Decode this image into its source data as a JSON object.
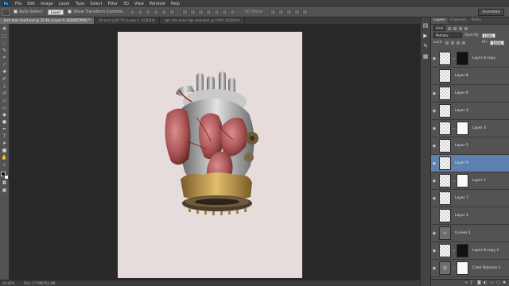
{
  "menubar": {
    "logo": "Ps",
    "items": [
      "File",
      "Edit",
      "Image",
      "Layer",
      "Type",
      "Select",
      "Filter",
      "3D",
      "View",
      "Window",
      "Help"
    ]
  },
  "options": {
    "auto_select_label": "Auto-Select:",
    "auto_select_value": "Layer",
    "transform_label": "Show Transform Controls",
    "mode_3d": "3D Mode:",
    "workspace": "Essentials"
  },
  "tabs": [
    {
      "label": "krrrr.mou heart.psd @ 33.4% (Layer 9, RGB/8/CMYK) *",
      "active": true
    },
    {
      "label": "fm.psd @ 66.7% (Layer 1, RGB/8#)",
      "active": false
    },
    {
      "label": "ngit ede webe itgo workspac @ 100% (RGB/8#)",
      "active": false
    }
  ],
  "status": {
    "zoom": "33.42%",
    "doc": "Doc: 17.0M/152.4M"
  },
  "panel": {
    "tabs": [
      "Layers",
      "Channels",
      "Paths"
    ],
    "kind_label": "Kind",
    "blend_mode": "Multiply",
    "opacity_label": "Opacity:",
    "opacity": "100%",
    "lock_label": "Lock:",
    "fill_label": "Fill:",
    "fill": "100%"
  },
  "layers": [
    {
      "name": "Layer 8 copy",
      "thumb": "transparent",
      "mask": "black",
      "eye": true,
      "selected": false
    },
    {
      "name": "Layer 8",
      "thumb": "transparent",
      "eye": false,
      "selected": false
    },
    {
      "name": "Layer 6",
      "thumb": "transparent",
      "eye": true,
      "selected": false
    },
    {
      "name": "Layer 4",
      "thumb": "transparent",
      "eye": true,
      "selected": false
    },
    {
      "name": "Layer 3",
      "thumb": "transparent",
      "mask": "white",
      "eye": true,
      "selected": false
    },
    {
      "name": "Layer 5",
      "thumb": "transparent",
      "eye": true,
      "selected": false
    },
    {
      "name": "Layer 9",
      "thumb": "transparent",
      "eye": true,
      "selected": true
    },
    {
      "name": "Layer 1",
      "thumb": "transparent",
      "mask": "white",
      "eye": true,
      "selected": false
    },
    {
      "name": "Layer 7",
      "thumb": "transparent",
      "eye": true,
      "selected": false
    },
    {
      "name": "Layer 2",
      "thumb": "transparent",
      "eye": false,
      "selected": false
    },
    {
      "name": "Curves 1",
      "thumb": "adjustment",
      "eye": true,
      "selected": false
    },
    {
      "name": "Layer 8 copy 2",
      "thumb": "transparent",
      "mask": "black",
      "eye": true,
      "selected": false
    },
    {
      "name": "Color Balance 1",
      "thumb": "adjustment",
      "mask": "white",
      "eye": true,
      "selected": false
    }
  ],
  "colors": {
    "selected_layer": "#5f81b0",
    "document_bg": "#e6dcdb",
    "panel_bg": "#535353"
  }
}
